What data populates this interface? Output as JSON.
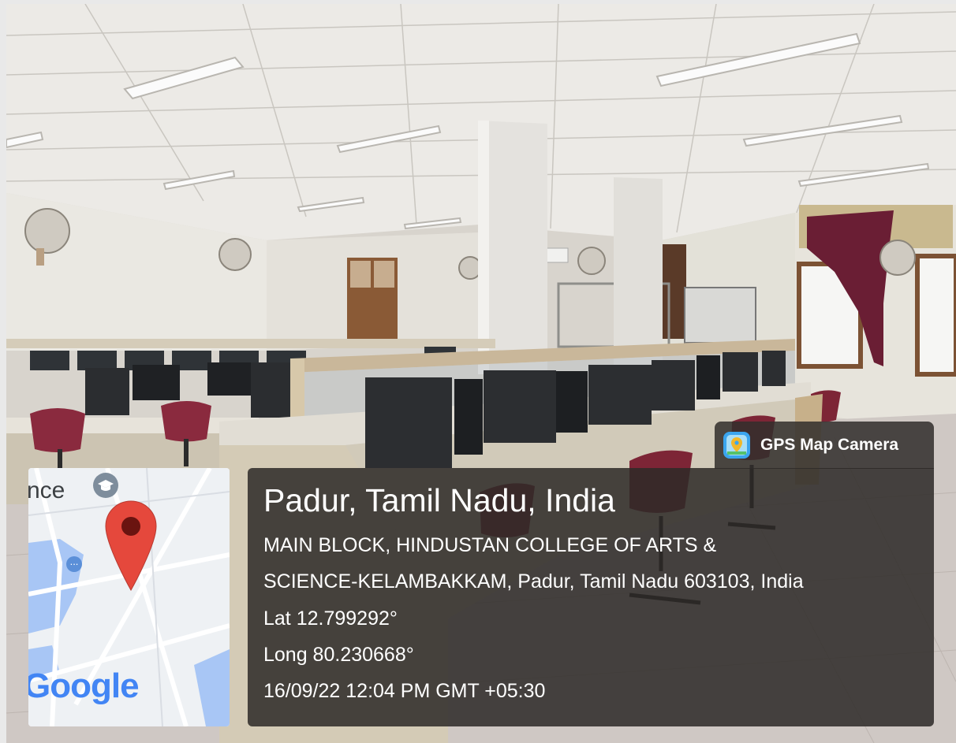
{
  "watermark": {
    "app_label": "GPS Map Camera",
    "app_icon": "map-pin-camera-icon"
  },
  "map": {
    "fragment_text": "nce",
    "provider_logo": "Google",
    "marker_color": "#e5483c"
  },
  "location": {
    "place": "Padur, Tamil Nadu, India",
    "address_line1": "MAIN BLOCK, HINDUSTAN COLLEGE OF ARTS &",
    "address_line2": "SCIENCE-KELAMBAKKAM, Padur, Tamil Nadu 603103, India",
    "lat": "Lat 12.799292°",
    "long": "Long 80.230668°",
    "datetime": "16/09/22 12:04 PM GMT +05:30"
  }
}
